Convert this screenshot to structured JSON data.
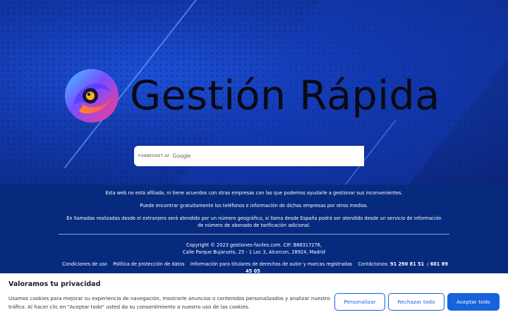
{
  "header": {
    "title": "Gestión Rápida",
    "search": {
      "brand_prefix": "FORBEDRET AF",
      "brand_name": "Google",
      "placeholder": ""
    }
  },
  "info": {
    "line1": "Esta web no está afiliada, ni tiene acuerdos con otras empresas con las que podemos ayudarle a gestionar sus inconvenientes.",
    "line2": "Puede encontrar gratuitamente los teléfonos e información de dichas empresas por otros medios.",
    "line3": "En llamadas realizadas desde el extranjero será atendido por un número geográfico, si llama desde España podrá ser atendido desde un servicio de información de número de abonado de tarificación adicional.",
    "copyright": "Copyright © 2023 gestiones-faciles.com. CIF: B88317276,",
    "address": "Calle Parque Bujaruelo, 25 - 1 Loc 3, Alcorcon, 28924, Madrid"
  },
  "footer_links": {
    "terms": "Condiciones de uso",
    "privacy": "Política de protección de datos",
    "copyright_info": "Información para titulares de derechos de autor y marcas registradas",
    "contact_label": "Contáctanos:",
    "phone1": "91 290 81 51",
    "separator": "/",
    "phone2": "601 89 45 05"
  },
  "cookie": {
    "title": "Valoramos tu privacidad",
    "text": "Usamos cookies para mejorar su experiencia de navegación, mostrarle anuncios o contenidos personalizados y analizar nuestro tráfico. Al hacer clic en \"Aceptar todo\" usted da su consentimiento a nuestro uso de las cookies.",
    "customize_label": "Personalizar",
    "reject_label": "Rechazar todo",
    "accept_label": "Aceptar todo"
  },
  "colors": {
    "accent": "#1863dc",
    "footer_bg": "#062a7e"
  }
}
